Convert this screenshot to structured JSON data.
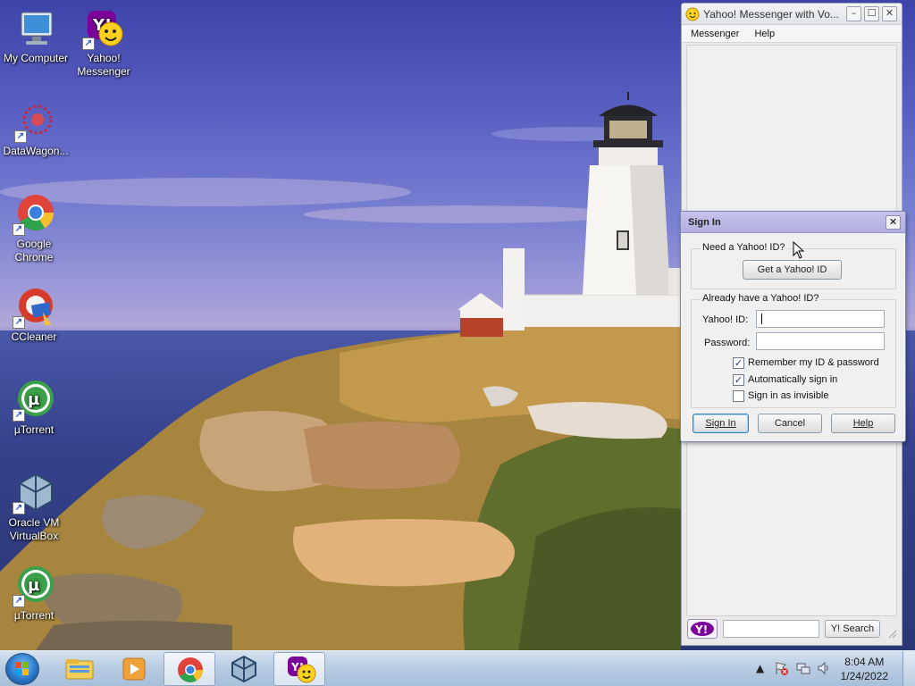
{
  "desktop": {
    "icons": [
      {
        "label": "My Computer",
        "icon": "computer-icon"
      },
      {
        "label": "Yahoo! Messenger",
        "icon": "yahoo-messenger-icon"
      },
      {
        "label": "DataWagon...",
        "icon": "datawagon-icon"
      },
      {
        "label": "Google Chrome",
        "icon": "chrome-icon"
      },
      {
        "label": "CCleaner",
        "icon": "ccleaner-icon"
      },
      {
        "label": "µTorrent",
        "icon": "utorrent-icon"
      },
      {
        "label": "Oracle VM VirtualBox",
        "icon": "virtualbox-icon"
      },
      {
        "label": "µTorrent",
        "icon": "utorrent-icon"
      }
    ]
  },
  "messenger": {
    "title": "Yahoo! Messenger with Vo...",
    "menu": [
      "Messenger",
      "Help"
    ],
    "search_button": "Y! Search",
    "search_value": ""
  },
  "signin": {
    "title": "Sign In",
    "need_id_heading": "Need a Yahoo! ID?",
    "get_id_button": "Get a Yahoo! ID",
    "have_id_heading": "Already have a Yahoo! ID?",
    "id_label": "Yahoo! ID:",
    "id_value": "",
    "password_label": "Password:",
    "password_value": "",
    "remember_label": "Remember my ID & password",
    "remember_checked": true,
    "auto_label": "Automatically sign in",
    "auto_checked": true,
    "invisible_label": "Sign in as invisible",
    "invisible_checked": false,
    "sign_in_button": "Sign In",
    "cancel_button": "Cancel",
    "help_button": "Help"
  },
  "taskbar": {
    "pinned": [
      "explorer-icon",
      "media-player-icon",
      "chrome-icon",
      "virtualbox-icon",
      "yahoo-messenger-icon"
    ],
    "active": "yahoo-messenger-icon",
    "time": "8:04 AM",
    "date": "1/24/2022"
  },
  "colors": {
    "yahoo_purple": "#7b0099",
    "dialog_title": "#b9b5e4",
    "taskbar": "#b9cde3"
  }
}
